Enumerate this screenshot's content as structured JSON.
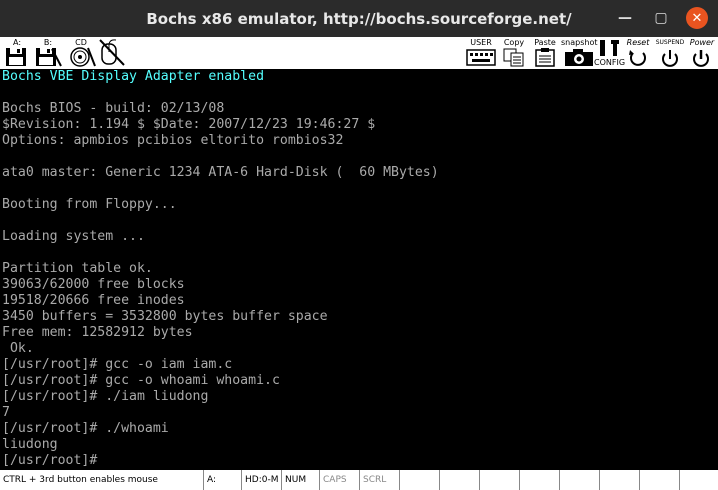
{
  "window": {
    "title": "Bochs x86 emulator, http://bochs.sourceforge.net/",
    "minimize_glyph": "—",
    "maximize_glyph": "▢",
    "close_glyph": "✕"
  },
  "toolbar": {
    "floppy_a": {
      "label": "A:",
      "icon": "floppy-icon"
    },
    "floppy_b": {
      "label": "B:",
      "icon": "floppy-icon"
    },
    "cdrom": {
      "label": "CD",
      "icon": "cdrom-icon"
    },
    "mouse": {
      "label": "",
      "icon": "mouse-icon"
    },
    "user": {
      "label": "USER",
      "icon": "keyboard-icon"
    },
    "copy": {
      "label": "Copy",
      "icon": "copy-icon"
    },
    "paste": {
      "label": "Paste",
      "icon": "paste-icon"
    },
    "snapshot": {
      "label": "snapshot",
      "icon": "camera-icon"
    },
    "config": {
      "label": "CONFIG",
      "icon": "config-icon"
    },
    "reset": {
      "label": "Reset",
      "icon": "reset-icon"
    },
    "suspend": {
      "label": "SUSPEND",
      "icon": "suspend-icon"
    },
    "power": {
      "label": "Power",
      "icon": "power-icon"
    }
  },
  "terminal": {
    "lines": [
      "Bochs VBE Display Adapter enabled",
      "",
      "Bochs BIOS - build: 02/13/08",
      "$Revision: 1.194 $ $Date: 2007/12/23 19:46:27 $",
      "Options: apmbios pcibios eltorito rombios32",
      "",
      "ata0 master: Generic 1234 ATA-6 Hard-Disk (  60 MBytes)",
      "",
      "Booting from Floppy...",
      "",
      "Loading system ...",
      "",
      "Partition table ok.",
      "39063/62000 free blocks",
      "19518/20666 free inodes",
      "3450 buffers = 3532800 bytes buffer space",
      "Free mem: 12582912 bytes",
      " Ok.",
      "[/usr/root]# gcc -o iam iam.c",
      "[/usr/root]# gcc -o whoami whoami.c",
      "[/usr/root]# ./iam liudong",
      "7",
      "[/usr/root]# ./whoami",
      "liudong",
      "[/usr/root]#"
    ],
    "colors": {
      "text": "#aaaaaa",
      "highlight": "#55ffff",
      "background": "#000000"
    }
  },
  "statusbar": {
    "hint": "CTRL + 3rd button enables mouse",
    "drive": "A:",
    "hd": "HD:0-M",
    "num": "NUM",
    "caps": "CAPS",
    "scrl": "SCRL"
  }
}
